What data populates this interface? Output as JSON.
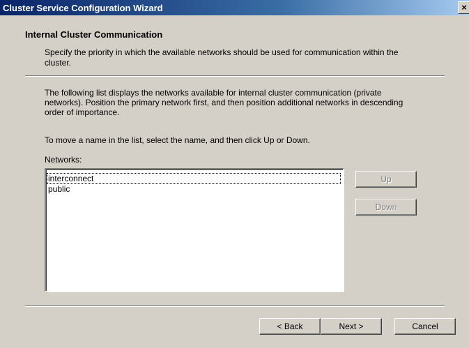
{
  "window": {
    "title": "Cluster Service Configuration Wizard",
    "close_symbol": "×"
  },
  "header": {
    "title": "Internal Cluster Communication",
    "description": "Specify the priority in which the available networks should be used for communication within the cluster."
  },
  "body": {
    "paragraph1": "The following list displays the networks available for internal cluster communication (private networks). Position the primary network first, and then position additional networks in descending order of importance.",
    "paragraph2": "To move a name in the list, select the name, and then click Up or Down.",
    "networks_label": "Networks:",
    "networks": [
      "interconnect",
      "public"
    ]
  },
  "buttons": {
    "up": "Up",
    "down": "Down",
    "back": "< Back",
    "next": "Next >",
    "cancel": "Cancel"
  }
}
